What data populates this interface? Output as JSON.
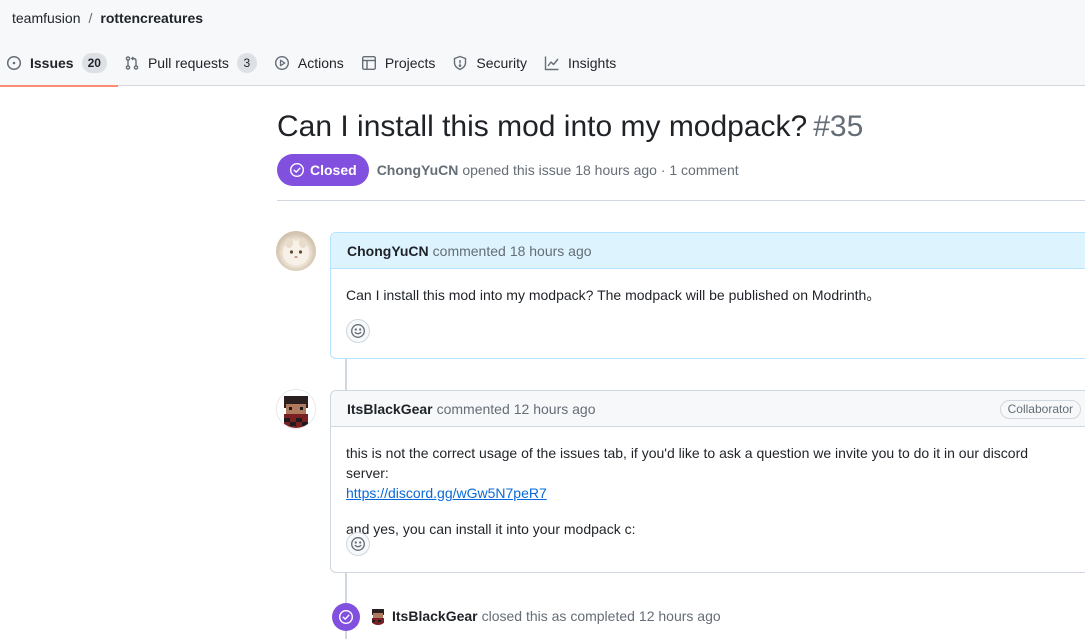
{
  "breadcrumb": {
    "owner": "teamfusion",
    "separator": "/",
    "repo": "rottencreatures"
  },
  "tabs": [
    {
      "label": "Issues",
      "count": "20",
      "icon": "issue-opened-icon",
      "selected": true
    },
    {
      "label": "Pull requests",
      "count": "3",
      "icon": "git-pull-request-icon"
    },
    {
      "label": "Actions",
      "icon": "play-icon"
    },
    {
      "label": "Projects",
      "icon": "table-icon"
    },
    {
      "label": "Security",
      "icon": "shield-icon"
    },
    {
      "label": "Insights",
      "icon": "graph-icon"
    }
  ],
  "issue": {
    "title": "Can I install this mod into my modpack?",
    "number": "#35",
    "state": "Closed",
    "author": "ChongYuCN",
    "meta_text": "opened this issue 18 hours ago · 1 comment"
  },
  "comments": [
    {
      "author": "ChongYuCN",
      "action": "commented",
      "time": "18 hours ago",
      "paragraphs": [
        "Can I install this mod into my modpack? The modpack will be published on Modrinth。"
      ]
    },
    {
      "author": "ItsBlackGear",
      "action": "commented",
      "time": "12 hours ago",
      "role": "Collaborator",
      "text_before_link": "this is not the correct usage of the issues tab, if you'd like to ask a question we invite you to do it in our discord server:",
      "link": "https://discord.gg/wGw5N7peR7",
      "text_after": "and yes, you can install it into your modpack c:"
    }
  ],
  "event": {
    "author": "ItsBlackGear",
    "action": "closed this as completed",
    "time": "12 hours ago"
  },
  "colors": {
    "accent_tab_underline": "#fd8c73",
    "closed_purple": "#8250df",
    "link_blue": "#0969da",
    "author_comment_bg": "#ddf4ff"
  }
}
